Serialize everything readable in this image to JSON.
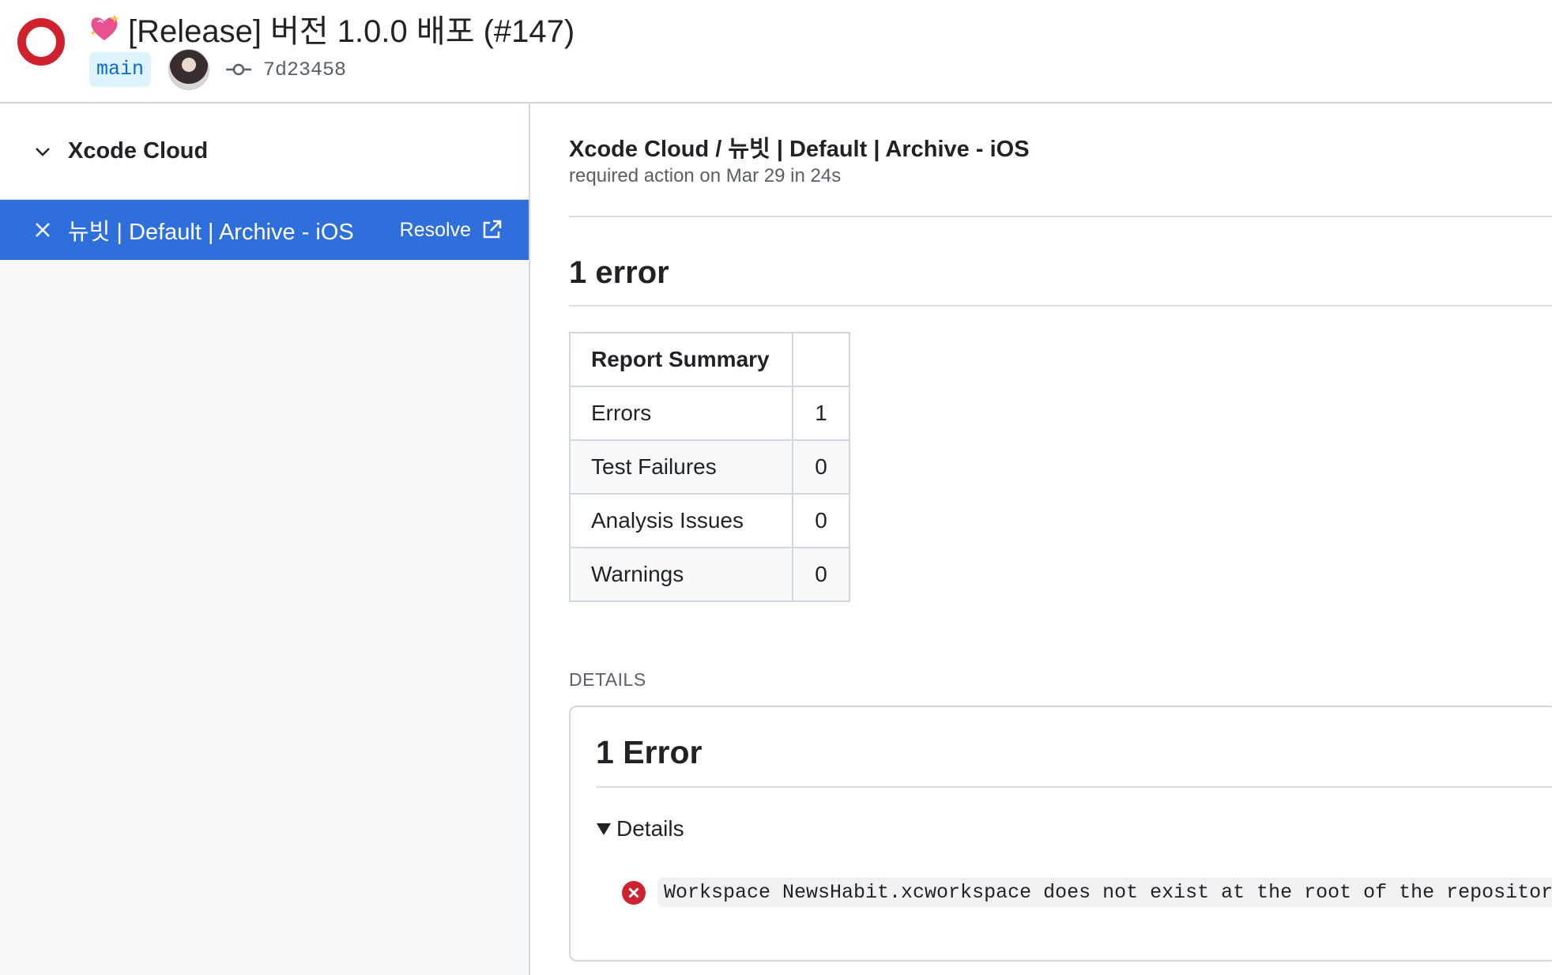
{
  "header": {
    "title": "[Release] 버전 1.0.0 배포 (#147)",
    "status_color": "#cf222e",
    "branch": "main",
    "commit_hash": "7d23458"
  },
  "sidebar": {
    "group_label": "Xcode Cloud",
    "job": {
      "label": "뉴빗 | Default | Archive - iOS",
      "resolve_label": "Resolve",
      "selected_color": "#2f6fdc"
    }
  },
  "main": {
    "job_title": "Xcode Cloud / 뉴빗 | Default | Archive - iOS",
    "job_subtitle": "required action on Mar 29 in 24s",
    "error_heading": "1 error",
    "summary": {
      "header": "Report Summary",
      "rows": [
        {
          "label": "Errors",
          "value": "1"
        },
        {
          "label": "Test Failures",
          "value": "0"
        },
        {
          "label": "Analysis Issues",
          "value": "0"
        },
        {
          "label": "Warnings",
          "value": "0"
        }
      ]
    },
    "details_caption": "DETAILS",
    "details_box": {
      "heading": "1 Error",
      "disclosure_label": "Details",
      "error_message": "Workspace NewsHabit.xcworkspace does not exist at the root of the repository"
    }
  },
  "icons": {
    "status": "failure-ring-icon",
    "title_emoji": "sparkling-heart-icon",
    "commit": "git-commit-icon",
    "chevron": "chevron-down-icon",
    "close": "x-icon",
    "external": "external-link-icon",
    "triangle": "disclosure-triangle-icon",
    "error": "error-circle-icon"
  }
}
